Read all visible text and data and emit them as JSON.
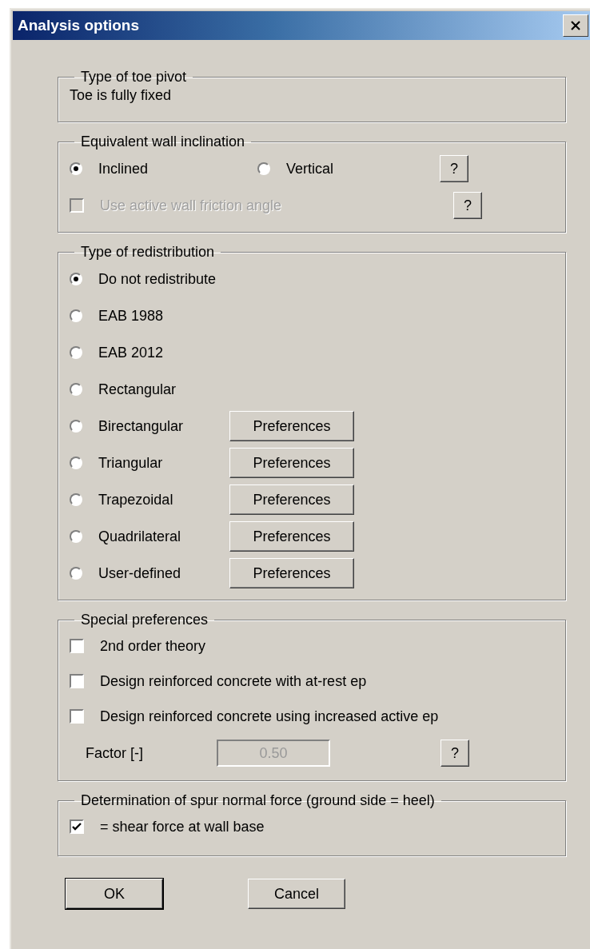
{
  "window": {
    "title": "Analysis options"
  },
  "toe_pivot": {
    "title": "Type of toe pivot",
    "text": "Toe is fully fixed"
  },
  "wall_inclination": {
    "title": "Equivalent wall inclination",
    "options": [
      {
        "label": "Inclined",
        "selected": true
      },
      {
        "label": "Vertical",
        "selected": false
      }
    ],
    "help_button": "?",
    "friction": {
      "label": "Use active wall friction angle",
      "checked": false,
      "disabled": true
    },
    "friction_help_button": "?"
  },
  "redistribution": {
    "title": "Type of redistribution",
    "options": [
      {
        "label": "Do not redistribute",
        "selected": true
      },
      {
        "label": "EAB 1988",
        "selected": false
      },
      {
        "label": "EAB 2012",
        "selected": false
      },
      {
        "label": "Rectangular",
        "selected": false
      },
      {
        "label": "Birectangular",
        "selected": false,
        "button": "Preferences"
      },
      {
        "label": "Triangular",
        "selected": false,
        "button": "Preferences"
      },
      {
        "label": "Trapezoidal",
        "selected": false,
        "button": "Preferences"
      },
      {
        "label": "Quadrilateral",
        "selected": false,
        "button": "Preferences"
      },
      {
        "label": "User-defined",
        "selected": false,
        "button": "Preferences"
      }
    ]
  },
  "special": {
    "title": "Special preferences",
    "checkboxes": [
      {
        "label": "2nd order theory",
        "checked": false
      },
      {
        "label": "Design reinforced concrete with at-rest ep",
        "checked": false
      },
      {
        "label": "Design reinforced concrete using increased active ep",
        "checked": false
      }
    ],
    "factor": {
      "label": "Factor [-]",
      "value": "0.50",
      "disabled": true
    },
    "help_button": "?"
  },
  "spur": {
    "title": "Determination of spur normal force (ground side = heel)",
    "checkbox": {
      "label": "= shear force at wall base",
      "checked": true
    }
  },
  "buttons": [
    {
      "label": "OK",
      "default": true
    },
    {
      "label": "Cancel",
      "default": false
    }
  ]
}
